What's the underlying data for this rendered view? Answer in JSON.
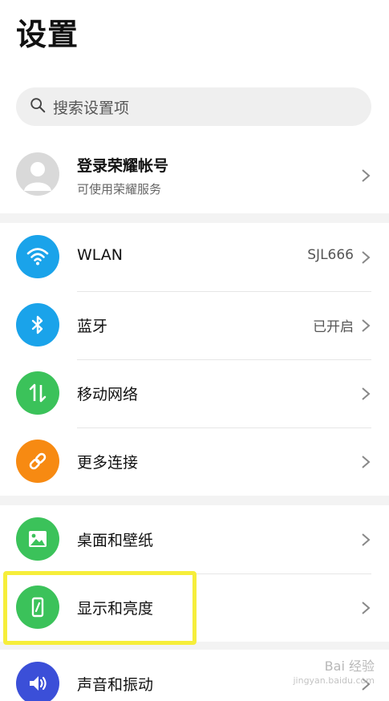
{
  "page": {
    "title": "设置"
  },
  "search": {
    "placeholder": "搜索设置项"
  },
  "account": {
    "title": "登录荣耀帐号",
    "subtitle": "可使用荣耀服务"
  },
  "sections": {
    "connectivity": [
      {
        "label": "WLAN",
        "value": "SJL666",
        "icon": "wifi-icon",
        "color": "#1aa3ea"
      },
      {
        "label": "蓝牙",
        "value": "已开启",
        "icon": "bluetooth-icon",
        "color": "#1aa3ea"
      },
      {
        "label": "移动网络",
        "value": "",
        "icon": "mobile-data-icon",
        "color": "#3bc25a"
      },
      {
        "label": "更多连接",
        "value": "",
        "icon": "link-icon",
        "color": "#f78a12"
      }
    ],
    "display": [
      {
        "label": "桌面和壁纸",
        "value": "",
        "icon": "wallpaper-icon",
        "color": "#3bc25a"
      },
      {
        "label": "显示和亮度",
        "value": "",
        "icon": "display-brightness-icon",
        "color": "#3bc25a"
      },
      {
        "label": "声音和振动",
        "value": "",
        "icon": "sound-icon",
        "color": "#3b4fd8"
      }
    ]
  },
  "watermark": {
    "text": "Bai 经验",
    "sub": "jingyan.baidu.com"
  }
}
